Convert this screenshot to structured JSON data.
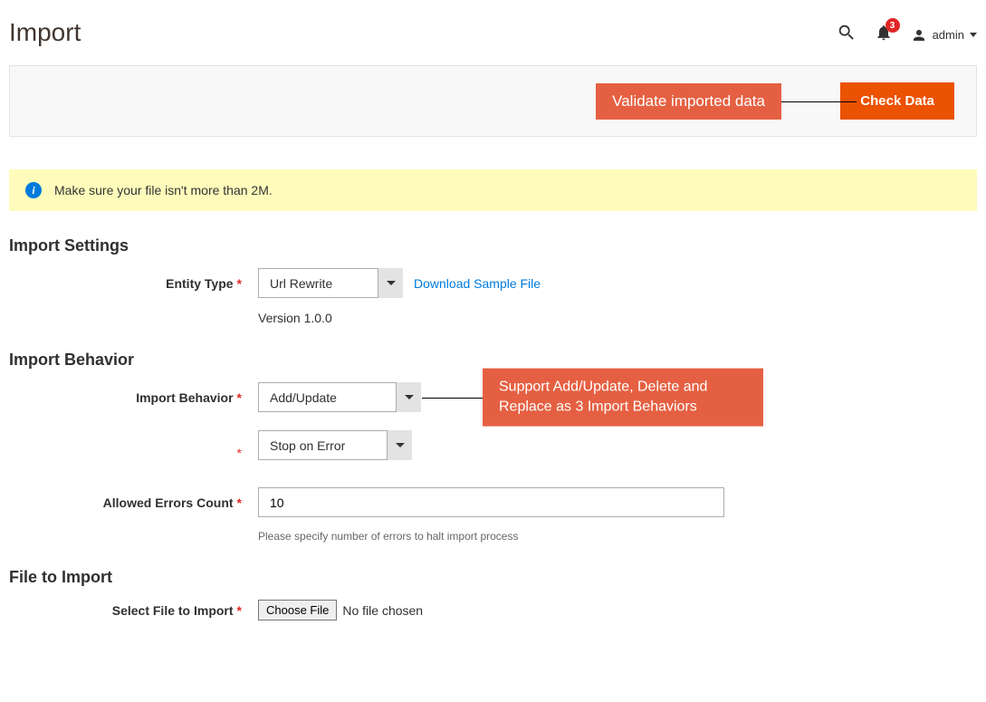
{
  "header": {
    "title": "Import",
    "notif_count": "3",
    "admin_label": "admin"
  },
  "toolbar": {
    "check_data_label": "Check Data",
    "callout_validate": "Validate imported data"
  },
  "banner": {
    "message": "Make sure your file isn't more than 2M."
  },
  "sections": {
    "import_settings": {
      "title": "Import Settings",
      "entity_type_label": "Entity Type",
      "entity_type_value": "Url Rewrite",
      "download_link": "Download Sample File",
      "version": "Version 1.0.0"
    },
    "import_behavior": {
      "title": "Import Behavior",
      "behavior_label": "Import Behavior",
      "behavior_value": "Add/Update",
      "callout_behavior": "Support Add/Update, Delete and Replace as 3 Import Behaviors",
      "error_strategy_value": "Stop on Error",
      "allowed_errors_label": "Allowed Errors Count",
      "allowed_errors_value": "10",
      "allowed_errors_hint": "Please specify number of errors to halt import process"
    },
    "file_to_import": {
      "title": "File to Import",
      "select_file_label": "Select File to Import",
      "choose_file_btn": "Choose File",
      "no_file_text": "No file chosen"
    }
  }
}
